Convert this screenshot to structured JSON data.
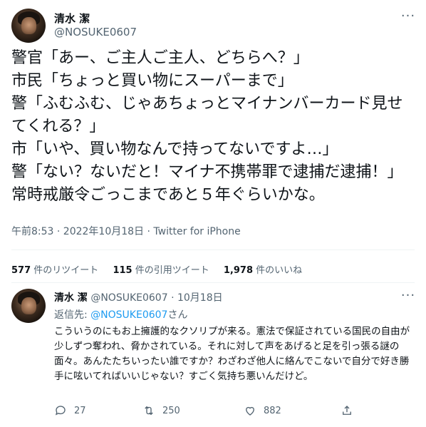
{
  "tweet": {
    "author_name": "清水 潔",
    "author_handle": "@NOSUKE0607",
    "more_icon": "more-horizontal-icon",
    "text": "警官「あー、ご主人ご主人、どちらへ？」\n市民「ちょっと買い物にスーパーまで」\n警「ふむふむ、じゃあちょっとマイナンバーカード見せてくれる？」\n市「いや、買い物なんで持ってないですよ…」\n警「ない？ないだと！マイナ不携帯罪で逮捕だ逮捕！」\n常時戒厳令ごっこまであと５年ぐらいかな。",
    "meta": "午前8:53 · 2022年10月18日 · Twitter for iPhone"
  },
  "stats": {
    "retweets_num": "577",
    "retweets_label": "件のリツイート",
    "quotes_num": "115",
    "quotes_label": "件の引用ツイート",
    "likes_num": "1,978",
    "likes_label": "件のいいね"
  },
  "reply": {
    "author_name": "清水 潔",
    "author_handle": "@NOSUKE0607",
    "separator": "·",
    "date": "10月18日",
    "replying_prefix": "返信先: ",
    "replying_handle": "@NOSUKE0607",
    "replying_suffix": "さん",
    "text": "こういうのにもお上擁護的なクソリプが来る。憲法で保証されている国民の自由が少しずつ奪われ、脅かされている。それに対して声をあげると足を引っ張る謎の面々。あんたたちいったい誰ですか？わざわざ他人に絡んでこないで自分で好き勝手に呟いてればいいじゃない？すごく気持ち悪いんだけど。",
    "reply_count": "27",
    "retweet_count": "250",
    "like_count": "882"
  },
  "colors": {
    "text": "#0f1419",
    "secondary": "#536471",
    "link": "#1d9bf0",
    "divider": "#eff3f4"
  }
}
